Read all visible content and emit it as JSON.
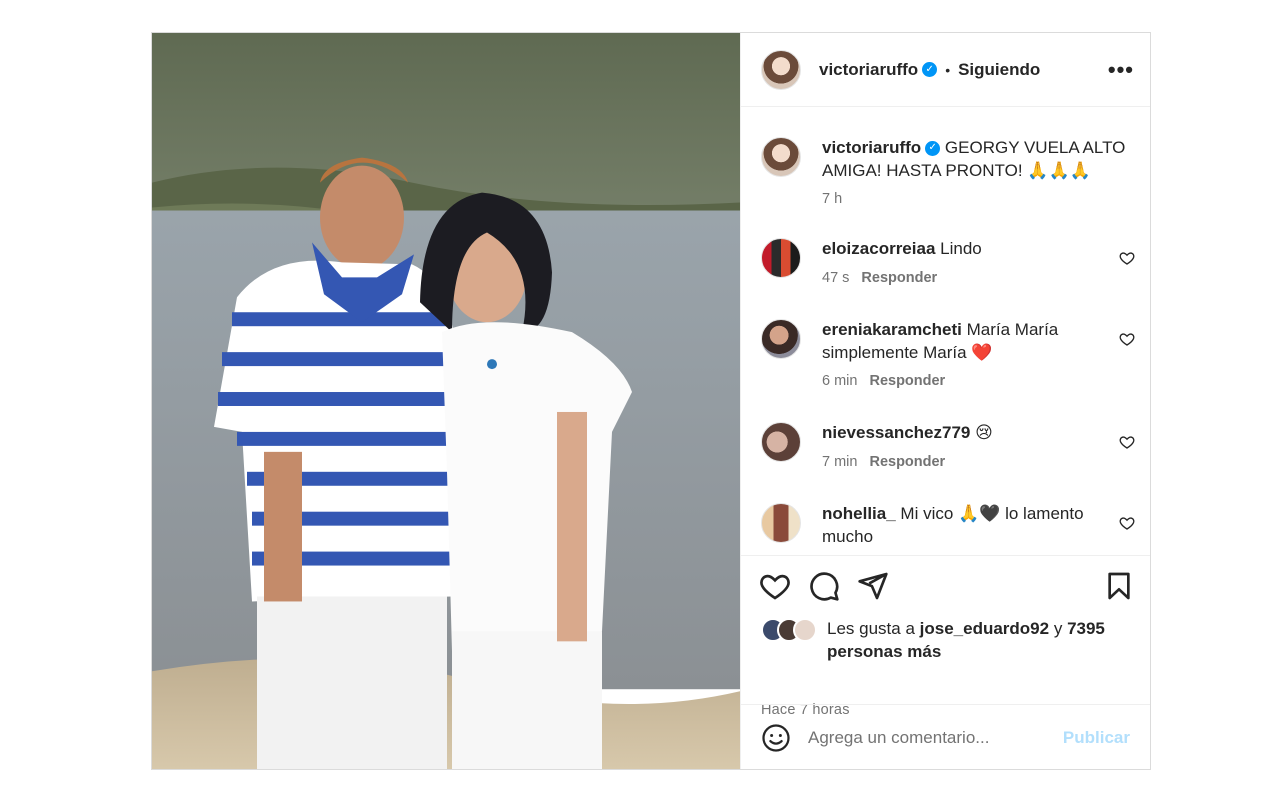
{
  "post": {
    "author": "victoriaruffo",
    "follow_status": "Siguiendo",
    "separator": "•",
    "more_label": "•••"
  },
  "caption": {
    "author": "victoriaruffo",
    "text": "GEORGY VUELA ALTO AMIGA! HASTA PRONTO! 🙏🙏🙏",
    "time": "7 h"
  },
  "comments": [
    {
      "user": "eloizacorreiaa",
      "text": "Lindo",
      "time": "47 s",
      "reply": "Responder"
    },
    {
      "user": "ereniakaramcheti",
      "text": "María María simplemente María ❤️",
      "time": "6 min",
      "reply": "Responder"
    },
    {
      "user": "nievessanchez779",
      "text": "😢",
      "time": "7 min",
      "reply": "Responder"
    },
    {
      "user": "nohellia_",
      "text": "Mi vico 🙏🖤 lo lamento mucho",
      "time": "",
      "reply": ""
    }
  ],
  "likes": {
    "prefix": "Les gusta a",
    "user": "jose_eduardo92",
    "connector": "y",
    "count": "7395",
    "suffix": "personas más"
  },
  "timestamp": "Hace 7 horas",
  "composer": {
    "placeholder": "Agrega un comentario...",
    "publish": "Publicar"
  },
  "icons": {
    "like": "heart-icon",
    "comment": "comment-icon",
    "share": "paper-plane-icon",
    "save": "bookmark-icon",
    "emoji": "emoji-icon",
    "verified": "verified-badge-icon"
  },
  "colors": {
    "verified": "#0095f6",
    "publish_disabled": "#b2dffc",
    "secondary_text": "#737373"
  }
}
